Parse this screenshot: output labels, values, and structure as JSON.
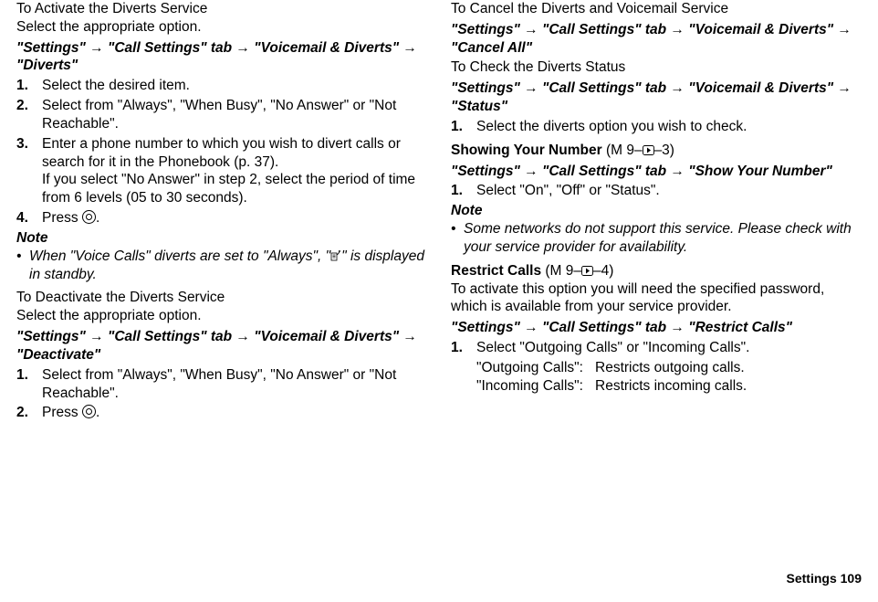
{
  "left": {
    "h1": "To Activate the Diverts Service",
    "sub1": "Select the appropriate option.",
    "path1_a": "\"Settings\"",
    "path1_b": "\"Call Settings\" tab",
    "path1_c": "\"Voicemail & Diverts\"",
    "path1_d": "\"Diverts\"",
    "s1": "Select the desired item.",
    "s2": "Select from \"Always\", \"When Busy\", \"No Answer\" or \"Not Reachable\".",
    "s3a": "Enter a phone number to which you wish to divert calls or search for it in the Phonebook (p. 37).",
    "s3b": "If you select \"No Answer\" in step 2, select the period of time from 6 levels (05 to 30 seconds).",
    "s4a": "Press ",
    "s4b": ".",
    "note": "Note",
    "n1a": "When \"Voice Calls\" diverts are set to \"Always\", \"",
    "n1b": "\" is displayed in standby.",
    "h2": "To Deactivate the Diverts Service",
    "sub2": "Select the appropriate option.",
    "path2_a": "\"Settings\"",
    "path2_b": "\"Call Settings\" tab",
    "path2_c": "\"Voicemail & Diverts\"",
    "path2_d": "\"Deactivate\"",
    "d1": "Select from \"Always\", \"When Busy\", \"No Answer\" or \"Not Reachable\".",
    "d2a": "Press ",
    "d2b": "."
  },
  "right": {
    "h1": "To Cancel the Diverts and Voicemail Service",
    "path1_a": "\"Settings\"",
    "path1_b": "\"Call Settings\" tab",
    "path1_c": "\"Voicemail & Diverts\"",
    "path1_d": "\"Cancel All\"",
    "h2": "To Check the Diverts Status",
    "path2_a": "\"Settings\"",
    "path2_b": "\"Call Settings\" tab",
    "path2_c": "\"Voicemail & Diverts\"",
    "path2_d": "\"Status\"",
    "c1": "Select the diverts option you wish to check.",
    "h3a": "Showing Your Number ",
    "h3b_pre": "(M 9–",
    "h3b_post": "–3)",
    "path3_a": "\"Settings\"",
    "path3_b": "\"Call Settings\" tab",
    "path3_c": "\"Show Your Number\"",
    "sy1": "Select \"On\", \"Off\" or \"Status\".",
    "note": "Note",
    "sn1": "Some networks do not support this service. Please check with your service provider for availability.",
    "h4a": "Restrict Calls ",
    "h4b_pre": "(M 9–",
    "h4b_post": "–4)",
    "rc_intro": "To activate this option you will need the specified password, which is available from your service provider.",
    "path4_a": "\"Settings\"",
    "path4_b": "\"Call Settings\" tab",
    "path4_c": "\"Restrict Calls\"",
    "rc1": "Select \"Outgoing Calls\" or \"Incoming Calls\".",
    "kv1k": "\"Outgoing Calls\":",
    "kv1v": "Restricts outgoing calls.",
    "kv2k": "\"Incoming Calls\":",
    "kv2v": "Restricts incoming calls."
  },
  "footer": "Settings  109",
  "arrow": "→"
}
